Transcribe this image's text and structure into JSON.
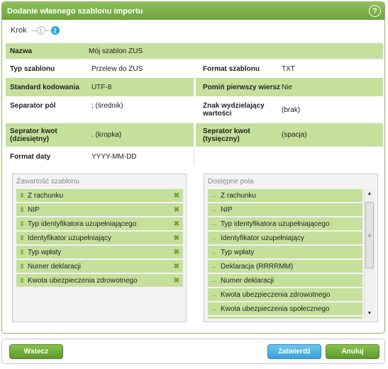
{
  "dialog": {
    "title": "Dodanie własnego szablonu importu",
    "help_icon": "?"
  },
  "steps": {
    "label": "Krok",
    "step1": "1",
    "step2": "2"
  },
  "fields": {
    "name_label": "Nazwa",
    "name_value": "Mój szablon ZUS",
    "type_label": "Typ szablonu",
    "type_value": "Przelew do ZUS",
    "format_label": "Format szablonu",
    "format_value": "TXT",
    "encoding_label": "Standard kodowania",
    "encoding_value": "UTF-8",
    "skipfirst_label": "Pomiń pierwszy wiersz",
    "skipfirst_value": "Nie",
    "fieldsep_label": "Separator pól",
    "fieldsep_value": "; (średnik)",
    "quote_label": "Znak wydzielający wartości",
    "quote_value": "(brak)",
    "decsep_label": "Seprator kwot (dziesiętny)",
    "decsep_value": ". (kropka)",
    "thousep_label": "Seprator kwot (tysięczny)",
    "thousep_value": "(spacja)",
    "date_label": "Format daty",
    "date_value": "YYYY-MM-DD"
  },
  "template_contents": {
    "title": "Zawartość szablonu",
    "items": [
      "Z rachunku",
      "NIP",
      "Typ identyfikatora uzupełniającego",
      "Identyfikator uzupełniający",
      "Typ wpłaty",
      "Numer deklaracji",
      "Kwota ubezpieczenia zdrowotnego"
    ]
  },
  "available_fields": {
    "title": "Dostępne pola",
    "items": [
      "Z rachunku",
      "NIP",
      "Typ identyfikatora uzupełniającego",
      "Identyfikator uzupełniający",
      "Typ wpłaty",
      "Deklaracja (RRRRMM)",
      "Numer deklaracji",
      "Kwota ubezpieczenia zdrowotnego",
      "Kwota ubezpieczenia społecznego"
    ]
  },
  "footer": {
    "back_label": "Wstecz",
    "confirm_label": "Zatwierdź",
    "cancel_label": "Anuluj"
  },
  "colors": {
    "accent_green": "#6fa33a",
    "row_green": "#c5e09b",
    "confirm_blue": "#3aa3d8"
  }
}
